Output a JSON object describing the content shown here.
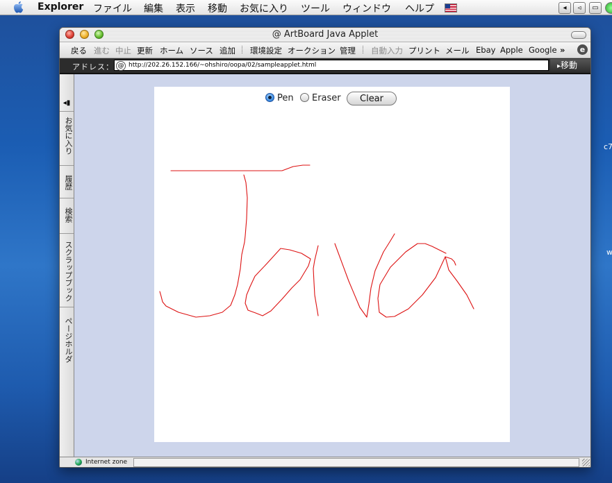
{
  "menubar": {
    "app_name": "Explorer",
    "menus": [
      "ファイル",
      "編集",
      "表示",
      "移動",
      "お気に入り",
      "ツール",
      "ウィンドウ",
      "ヘルプ"
    ],
    "tray_icons": [
      "volume-icon",
      "sound-icon",
      "display-icon"
    ]
  },
  "desktop": {
    "fragment_1": "c7",
    "fragment_2": "w"
  },
  "window": {
    "title": "ArtBoard Java Applet",
    "toolbar": {
      "items": [
        "戻る",
        "進む",
        "中止",
        "更新",
        "ホーム",
        "ソース",
        "追加",
        "環境設定",
        "オークション",
        "管理",
        "自動入力",
        "プリント",
        "メール",
        "Ebay",
        "Apple",
        "Google"
      ],
      "disabled": [
        "進む",
        "中止",
        "自動入力"
      ],
      "overflow": "»"
    },
    "address": {
      "label": "アドレス：",
      "url": "http://202.26.152.166/~ohshiro/oopa/02/sampleapplet.html",
      "go_label": "移動"
    },
    "sidebar_tabs": [
      "お気に入り",
      "履歴",
      "検索",
      "スクラップブック",
      "ページホルダ"
    ],
    "status": {
      "text": "Internet zone"
    }
  },
  "applet": {
    "tools": {
      "pen_label": "Pen",
      "eraser_label": "Eraser",
      "selected": "Pen"
    },
    "clear_label": "Clear",
    "stroke_color": "#dd1111",
    "background_color": "#ffffff"
  },
  "colors": {
    "content_bg": "#cdd5eb",
    "address_bar_bg": "#2c2c2c"
  }
}
